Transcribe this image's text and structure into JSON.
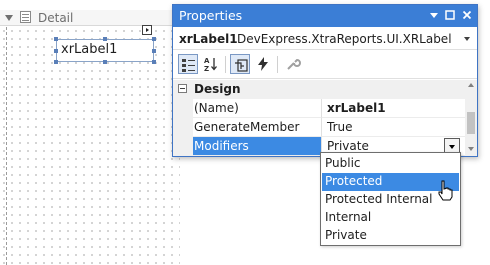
{
  "designer": {
    "band_label": "Detail",
    "label_text": "xrLabel1"
  },
  "properties": {
    "title": "Properties",
    "object_name": "xrLabel1",
    "object_type": "DevExpress.XtraReports.UI.XRLabel",
    "category": "Design",
    "rows": [
      {
        "name": "(Name)",
        "value": "xrLabel1"
      },
      {
        "name": "GenerateMember",
        "value": "True"
      },
      {
        "name": "Modifiers",
        "value": "Private"
      }
    ]
  },
  "dropdown": {
    "options": [
      "Public",
      "Protected",
      "Protected Internal",
      "Internal",
      "Private"
    ],
    "highlighted": "Protected"
  },
  "colors": {
    "accent": "#3b7ed6",
    "selection": "#3c8ae3"
  }
}
